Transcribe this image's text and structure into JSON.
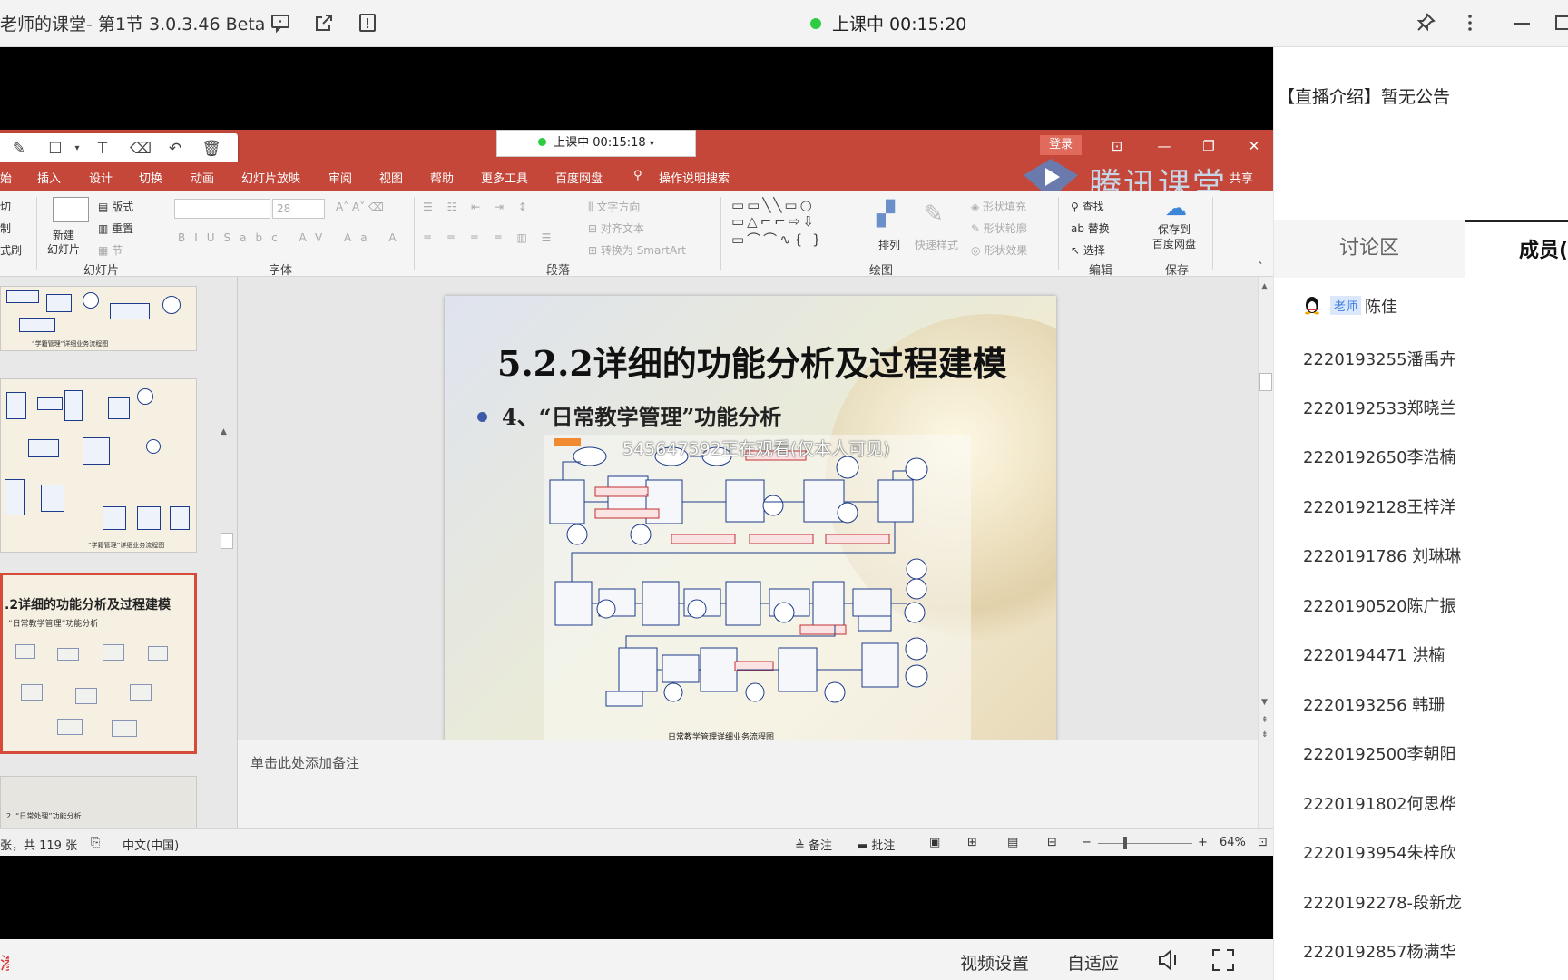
{
  "app": {
    "title": "老师的课堂- 第1节 3.0.3.46 Beta",
    "live_status": "上课中 00:15:20"
  },
  "ppt": {
    "inner_status": "上课中 00:15:18",
    "login_label": "登录",
    "share_label": "共享",
    "logo_text": "腾讯课堂",
    "menu": [
      "始",
      "插入",
      "设计",
      "切换",
      "动画",
      "幻灯片放映",
      "审阅",
      "视图",
      "帮助",
      "更多工具",
      "百度网盘",
      "操作说明搜索"
    ],
    "ribbon": {
      "clipboard": [
        "切",
        "制",
        "式刷"
      ],
      "new_slide": "新建\n幻灯片",
      "layout": "版式",
      "reset": "重置",
      "section": "节",
      "font_size": "28",
      "text_direction": "文字方向",
      "align_text": "对齐文本",
      "smartart": "转换为 SmartArt",
      "arrange": "排列",
      "quick_styles": "快速样式",
      "shape_fill": "形状填充",
      "shape_outline": "形状轮廓",
      "shape_effect": "形状效果",
      "find": "查找",
      "replace": "替换",
      "select": "选择",
      "save_baidu": "保存到\n百度网盘",
      "groups": {
        "slides": "幻灯片",
        "font": "字体",
        "paragraph": "段落",
        "drawing": "绘图",
        "edit": "编辑",
        "save": "保存"
      }
    },
    "thumbnails": {
      "selected_title": ".2详细的功能分析及过程建模",
      "selected_subtitle": "“日常教学管理”功能分析",
      "next_subtitle": "2. “日常处理”功能分析",
      "caption_a": "“学籍管理”详细业务流程图",
      "caption_b": "“学籍管理”详细业务流程图"
    },
    "slide": {
      "title": "5.2.2详细的功能分析及过程建模",
      "bullet": "4、“日常教学管理”功能分析",
      "diagram_caption": "日常教学管理详细业务流程图",
      "watermark": "545647592正在观看(仅本人可见)"
    },
    "notes_placeholder": "单击此处添加备注",
    "statusbar": {
      "slide_count": "张，共 119 张",
      "language": "中文(中国)",
      "notes": "备注",
      "comments": "批注",
      "zoom": "64%"
    }
  },
  "bottombar": {
    "left_char": "渗",
    "video_settings": "视频设置",
    "adaptive": "自适应"
  },
  "side": {
    "announcement": "【直播介绍】暂无公告",
    "tab_discuss": "讨论区",
    "tab_members": "成员(",
    "teacher_badge": "老师",
    "teacher_name": "陈佳",
    "members": [
      "2220193255潘禹卉",
      "2220192533郑晓兰",
      "2220192650李浩楠",
      "2220192128王梓洋",
      "2220191786 刘琳琳",
      "2220190520陈广振",
      "2220194471 洪楠",
      "2220193256 韩珊",
      "2220192500李朝阳",
      "2220191802何思桦",
      "2220193954朱梓欣",
      "2220192278-段新龙",
      "2220192857杨满华"
    ]
  },
  "colors": {
    "ppt_red": "#c4473a",
    "live_green": "#2ecc40",
    "selected_thumb": "#d64a3a"
  },
  "icons": [
    "chat-icon",
    "share-out-icon",
    "alert-icon",
    "pin-icon",
    "more-icon",
    "minimize-icon",
    "speaker-icon",
    "fullscreen-icon"
  ]
}
